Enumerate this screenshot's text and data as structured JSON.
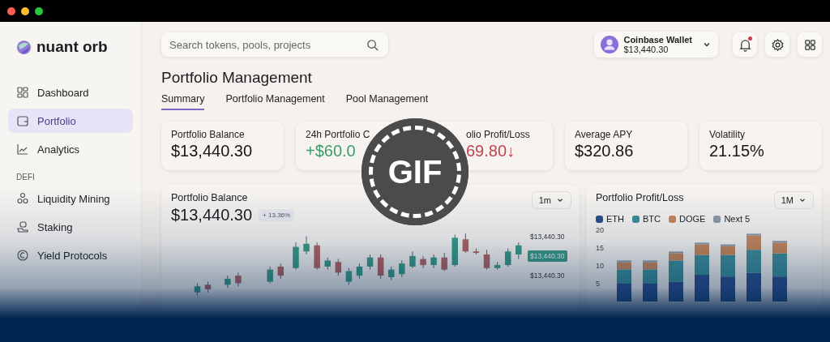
{
  "brand": "nuant orb",
  "nav": [
    {
      "label": "Dashboard",
      "selected": false
    },
    {
      "label": "Portfolio",
      "selected": true
    },
    {
      "label": "Analytics",
      "selected": false
    }
  ],
  "nav_section": "DEFI",
  "defi_nav": [
    {
      "label": "Liquidity Mining",
      "selected": false
    },
    {
      "label": "Staking",
      "selected": false
    },
    {
      "label": "Yield Protocols",
      "selected": false
    }
  ],
  "search": {
    "placeholder": "Search tokens, pools, projects"
  },
  "wallet": {
    "name": "Coinbase Wallet",
    "balance": "$13,440.30"
  },
  "notifications": {
    "unread": true
  },
  "page_title": "Portfolio Management",
  "tabs": [
    {
      "label": "Summary",
      "selected": true
    },
    {
      "label": "Portfolio Management",
      "selected": false
    },
    {
      "label": "Pool Management",
      "selected": false
    }
  ],
  "stats": [
    {
      "label": "Portfolio Balance",
      "value": "$13,440.30",
      "kind": "plain"
    },
    {
      "label": "24h Portfolio C",
      "value": "+$60.0",
      "kind": "gain"
    },
    {
      "label": "olio Profit/Loss",
      "value": "69.80",
      "arrow": "↓",
      "kind": "loss"
    },
    {
      "label": "Average APY",
      "value": "$320.86",
      "kind": "plain"
    },
    {
      "label": "Volatility",
      "value": "21.15%",
      "kind": "plain"
    }
  ],
  "balance_panel": {
    "title": "Portfolio Balance",
    "value": "$13,440.30",
    "change": "+ 13.36%",
    "range": "1m",
    "price_labels": [
      {
        "text": "$13,440.30",
        "highlighted": false
      },
      {
        "text": "$13,440.30",
        "highlighted": true
      },
      {
        "text": "$13,440.30",
        "highlighted": false
      }
    ]
  },
  "pl_panel": {
    "title": "Portfolio Profit/Loss",
    "range": "1M",
    "chart_data": {
      "type": "bar",
      "stacked": true,
      "yticks": [
        5,
        10,
        15,
        20
      ],
      "ylim": [
        0,
        20
      ],
      "series": [
        {
          "name": "ETH",
          "color": "#2c4f8c",
          "values": [
            5,
            5,
            5.5,
            7.5,
            7,
            8,
            7
          ]
        },
        {
          "name": "BTC",
          "color": "#3e8e98",
          "values": [
            4,
            4,
            6,
            5.5,
            6,
            6.5,
            6.5
          ]
        },
        {
          "name": "DOGE",
          "color": "#c8875a",
          "values": [
            2,
            2,
            2,
            3,
            2.5,
            4,
            3
          ]
        },
        {
          "name": "Next 5",
          "color": "#8d9aa6",
          "values": [
            0.5,
            0.5,
            0.5,
            0.5,
            0.5,
            0.5,
            0.5
          ]
        }
      ]
    }
  },
  "gif_badge": "GIF"
}
